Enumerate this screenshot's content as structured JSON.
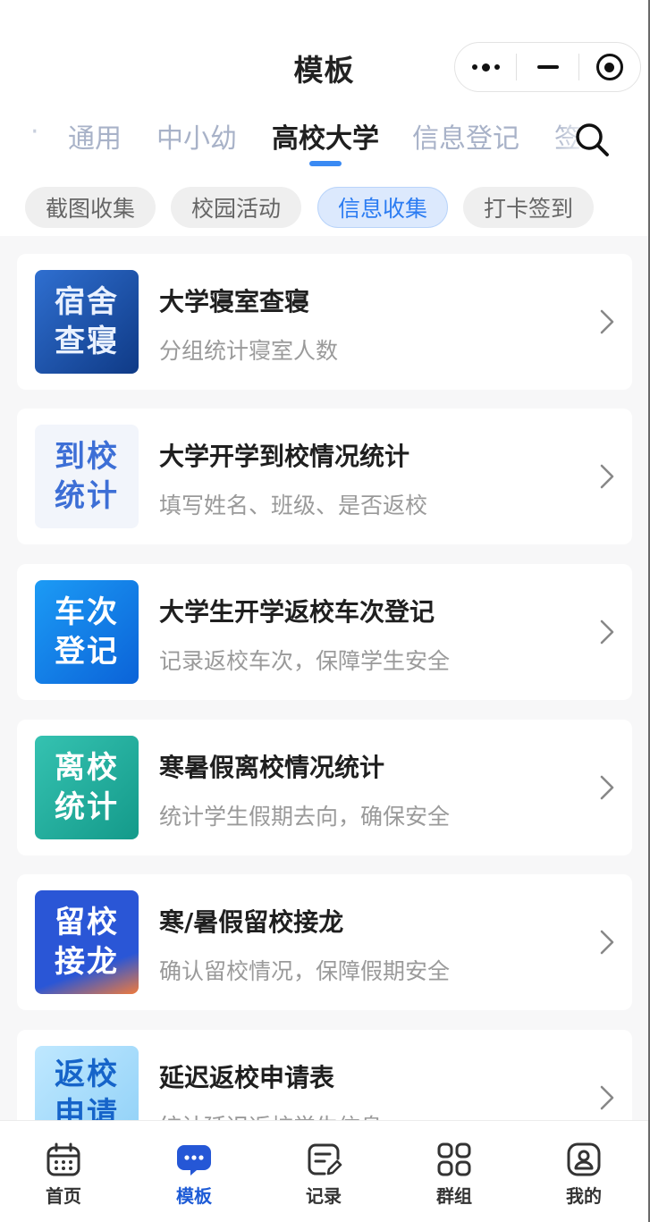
{
  "header": {
    "title": "模板"
  },
  "capsule": {
    "more_icon": "more-dots-icon",
    "minimize_icon": "minimize-icon",
    "close_icon": "target-close-icon"
  },
  "tabs": [
    {
      "label": "通用"
    },
    {
      "label": "中小幼"
    },
    {
      "label": "高校大学"
    },
    {
      "label": "信息登记"
    },
    {
      "label": "签"
    }
  ],
  "active_tab": "高校大学",
  "chips": [
    {
      "label": "截图收集"
    },
    {
      "label": "校园活动"
    },
    {
      "label": "信息收集"
    },
    {
      "label": "打卡签到"
    }
  ],
  "active_chip": "信息收集",
  "templates": [
    {
      "title": "大学寝室查寝",
      "subtitle": "分组统计寝室人数",
      "thumb_line1": "宿舍",
      "thumb_line2": "查寝"
    },
    {
      "title": "大学开学到校情况统计",
      "subtitle": "填写姓名、班级、是否返校",
      "thumb_line1": "到校",
      "thumb_line2": "统计"
    },
    {
      "title": "大学生开学返校车次登记",
      "subtitle": "记录返校车次，保障学生安全",
      "thumb_line1": "车次",
      "thumb_line2": "登记"
    },
    {
      "title": "寒暑假离校情况统计",
      "subtitle": "统计学生假期去向，确保安全",
      "thumb_line1": "离校",
      "thumb_line2": "统计"
    },
    {
      "title": "寒/暑假留校接龙",
      "subtitle": "确认留校情况，保障假期安全",
      "thumb_line1": "留校",
      "thumb_line2": "接龙"
    },
    {
      "title": "延迟返校申请表",
      "subtitle": "统计延迟返校学生信息",
      "thumb_line1": "返校",
      "thumb_line2": "申请"
    }
  ],
  "bottom_nav": [
    {
      "label": "首页",
      "icon": "calendar-icon"
    },
    {
      "label": "模板",
      "icon": "chat-bubble-icon"
    },
    {
      "label": "记录",
      "icon": "edit-record-icon"
    },
    {
      "label": "群组",
      "icon": "grid-icon"
    },
    {
      "label": "我的",
      "icon": "profile-icon"
    }
  ],
  "colors": {
    "accent": "#3a8af3",
    "nav_active": "#1d5bd6",
    "tab_inactive": "#a8b2c8",
    "subtitle": "#9a9a9a"
  }
}
